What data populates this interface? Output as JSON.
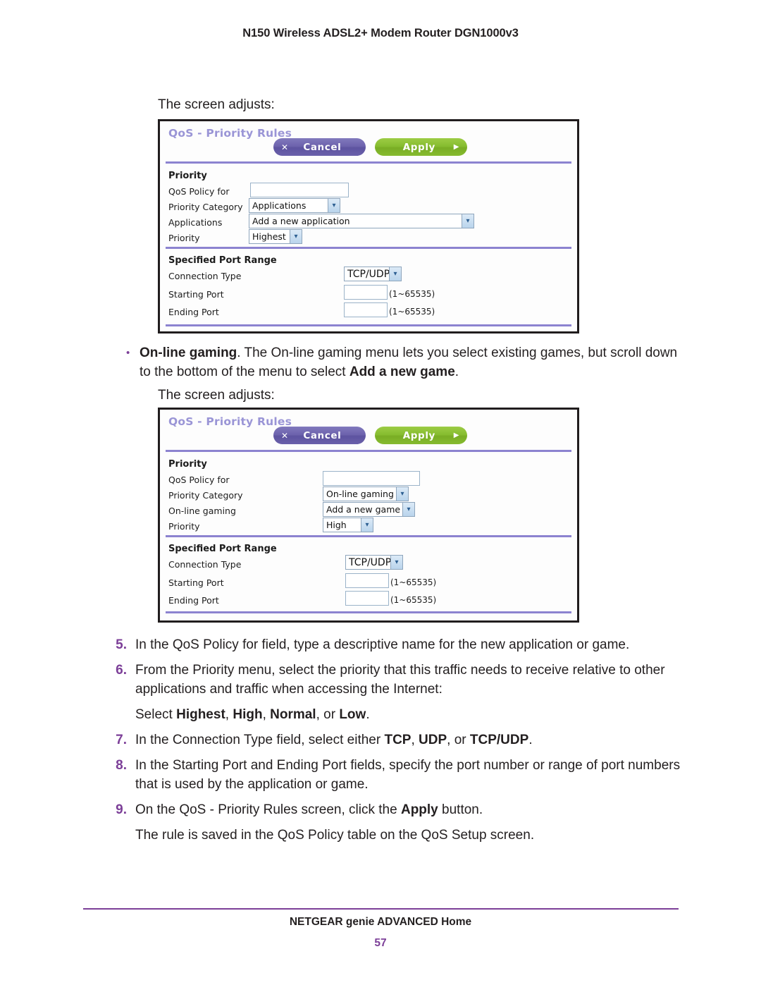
{
  "header": {
    "title": "N150 Wireless ADSL2+ Modem Router DGN1000v3"
  },
  "colors": {
    "accent_purple": "#7c3f98",
    "panel_title": "#9a95d6",
    "divider": "#8c83d0",
    "cancel_button": "#6d63ad",
    "apply_button": "#87bd30"
  },
  "lead_1": "The screen adjusts:",
  "lead_2": "The screen adjusts:",
  "bullet": {
    "marker": "•",
    "term": "On-line gaming",
    "text_after_term": ". The On-line gaming menu lets you select existing games, but scroll down to the bottom of the menu to select ",
    "emphasis": "Add a new game",
    "tail": "."
  },
  "panel_applications": {
    "title": "QoS - Priority Rules",
    "cancel_label": "Cancel",
    "cancel_glyph": "✕",
    "apply_label": "Apply",
    "apply_glyph": "▶",
    "priority_section": {
      "heading": "Priority",
      "fields": [
        {
          "label": "QoS Policy for",
          "type": "text",
          "value": ""
        },
        {
          "label": "Priority Category",
          "type": "select",
          "value": "Applications"
        },
        {
          "label": "Applications",
          "type": "select",
          "value": "Add a new application"
        },
        {
          "label": "Priority",
          "type": "select",
          "value": "Highest"
        }
      ]
    },
    "port_section": {
      "heading": "Specified Port Range",
      "fields": [
        {
          "label": "Connection Type",
          "type": "select",
          "value": "TCP/UDP",
          "hint": ""
        },
        {
          "label": "Starting Port",
          "type": "text",
          "value": "",
          "hint": "(1~65535)"
        },
        {
          "label": "Ending Port",
          "type": "text",
          "value": "",
          "hint": "(1~65535)"
        }
      ]
    }
  },
  "panel_gaming": {
    "title": "QoS - Priority Rules",
    "cancel_label": "Cancel",
    "cancel_glyph": "✕",
    "apply_label": "Apply",
    "apply_glyph": "▶",
    "priority_section": {
      "heading": "Priority",
      "fields": [
        {
          "label": "QoS Policy for",
          "type": "text",
          "value": ""
        },
        {
          "label": "Priority Category",
          "type": "select",
          "value": "On-line gaming"
        },
        {
          "label": "On-line gaming",
          "type": "select",
          "value": "Add a new game"
        },
        {
          "label": "Priority",
          "type": "select",
          "value": "High"
        }
      ]
    },
    "port_section": {
      "heading": "Specified Port Range",
      "fields": [
        {
          "label": "Connection Type",
          "type": "select",
          "value": "TCP/UDP",
          "hint": ""
        },
        {
          "label": "Starting Port",
          "type": "text",
          "value": "",
          "hint": "(1~65535)"
        },
        {
          "label": "Ending Port",
          "type": "text",
          "value": "",
          "hint": "(1~65535)"
        }
      ]
    }
  },
  "steps": {
    "s5_num": "5.",
    "s5_text": "In the QoS Policy for field, type a descriptive name for the new application or game.",
    "s6_num": "6.",
    "s6_text": "From the Priority menu, select the priority that this traffic needs to receive relative to other applications and traffic when accessing the Internet:",
    "s6_sub_lead": "Select ",
    "s6_sub_o1": "Highest",
    "s6_sub_sep1": ", ",
    "s6_sub_o2": "High",
    "s6_sub_sep2": ", ",
    "s6_sub_o3": "Normal",
    "s6_sub_sep3": ", or ",
    "s6_sub_o4": "Low",
    "s6_sub_tail": ".",
    "s7_num": "7.",
    "s7_lead": "In the Connection Type field, select either ",
    "s7_o1": "TCP",
    "s7_sep1": ", ",
    "s7_o2": "UDP",
    "s7_sep2": ", or ",
    "s7_o3": "TCP/UDP",
    "s7_tail": ".",
    "s8_num": "8.",
    "s8_text": "In the Starting Port and Ending Port fields, specify the port number or range of port numbers that is used by the application or game.",
    "s9_num": "9.",
    "s9_lead": "On the QoS - Priority Rules screen, click the ",
    "s9_em": "Apply",
    "s9_tail": " button.",
    "s9_sub": "The rule is saved in the QoS Policy table on the QoS Setup screen."
  },
  "footer": {
    "text": "NETGEAR genie ADVANCED Home",
    "page": "57"
  }
}
